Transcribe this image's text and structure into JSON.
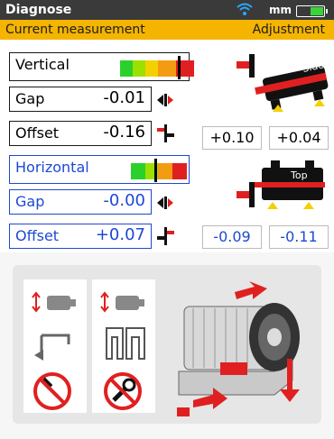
{
  "statusbar": {
    "title": "Diagnose",
    "unit": "mm",
    "wifi_icon": "wifi-icon",
    "battery_icon": "battery-icon"
  },
  "header": {
    "left": "Current measurement",
    "right": "Adjustment"
  },
  "vertical": {
    "label": "Vertical",
    "gap": {
      "label": "Gap",
      "value": "-0.01"
    },
    "offset": {
      "label": "Offset",
      "value": "-0.16"
    },
    "adjust_left": "+0.10",
    "adjust_right": "+0.04",
    "view_label": "Side"
  },
  "horizontal": {
    "label": "Horizontal",
    "gap": {
      "label": "Gap",
      "value": "-0.00"
    },
    "offset": {
      "label": "Offset",
      "value": "+0.07"
    },
    "adjust_left": "-0.09",
    "adjust_right": "-0.11",
    "view_label": "Top"
  },
  "colors": {
    "accent": "#f4b400",
    "blue": "#1d48d4",
    "red": "#e02020",
    "green": "#2bd12b",
    "orange": "#f39c12"
  },
  "diagnose_panel": {
    "icons": [
      "motor-vertical-icon",
      "clamp-icon",
      "no-hammer-icon",
      "motor-vertical-icon",
      "shims-icon",
      "no-wrench-icon",
      "motor-adjustment-icon"
    ]
  }
}
